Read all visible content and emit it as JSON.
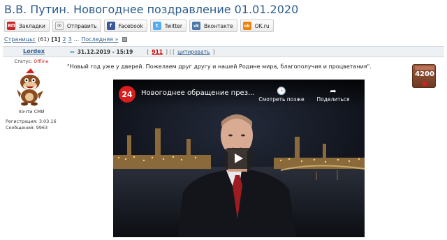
{
  "topic": {
    "title": "В.В. Путин. Новогоднее поздравление 01.01.2020"
  },
  "share": [
    {
      "label": "Закладки",
      "icon": "yap-bookmarks-icon",
      "color": "#cc2020",
      "glyph": "ЯП"
    },
    {
      "label": "Отправить",
      "icon": "mail-icon",
      "color": "#eeeeee",
      "glyph": "✉"
    },
    {
      "label": "Facebook",
      "icon": "facebook-icon",
      "color": "#3b5998",
      "glyph": "f"
    },
    {
      "label": "Twitter",
      "icon": "twitter-icon",
      "color": "#55acee",
      "glyph": "t"
    },
    {
      "label": "Вконтакте",
      "icon": "vk-icon",
      "color": "#4a76a8",
      "glyph": "vk"
    },
    {
      "label": "OK.ru",
      "icon": "ok-icon",
      "color": "#ee8208",
      "glyph": "ok"
    }
  ],
  "pagination": {
    "label": "Страницы:",
    "count": "(61)",
    "current": "[1]",
    "page2": "2",
    "page3": "3",
    "ellipsis": "...",
    "last": "Последняя »"
  },
  "post": {
    "author": "Lordex",
    "date": "31.12.2019 - 15:19",
    "rating": "911",
    "quote_label": "цитировать",
    "body": "\"Новый год уже у дверей. Пожелаем друг другу и нашей Родине мира, благополучия и процветания\".",
    "vote_count": "4200"
  },
  "profile": {
    "status_label": "Статус:",
    "status_value": "Offline",
    "rank": "почти СМИ",
    "registered": "Регистрация: 3.03.16",
    "messages": "Сообщений: 9963"
  },
  "video": {
    "channel_badge": "24",
    "title": "Новогоднее обращение през...",
    "watch_later": "Смотреть позже",
    "share": "Поделиться"
  },
  "colors": {
    "link": "#2d5c8b",
    "offline": "#cc2222",
    "rating": "#cc0000"
  }
}
